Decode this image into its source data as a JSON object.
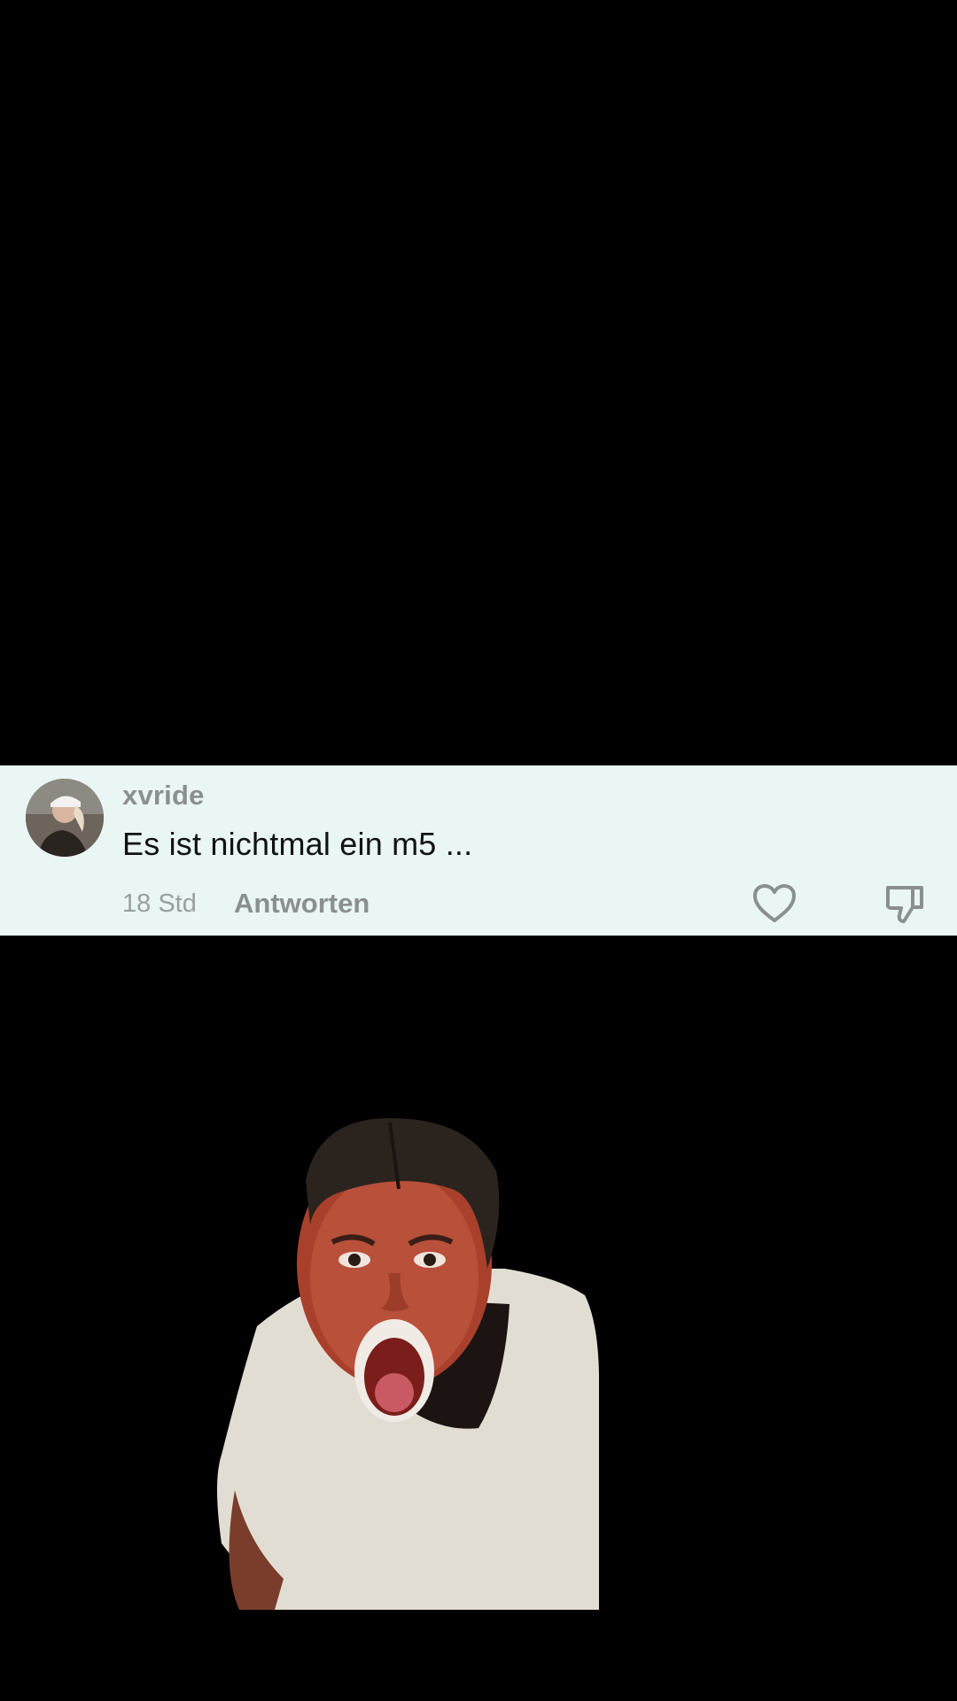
{
  "comment": {
    "username": "xvride",
    "text": "Es ist nichtmal ein m5 ...",
    "time": "18 Std",
    "reply_label": "Antworten",
    "like_icon": "heart-outline-icon",
    "dislike_icon": "thumbs-down-icon"
  },
  "colors": {
    "background": "#000000",
    "card_background": "#eaf6f4",
    "username": "#8a8f8f",
    "comment_text": "#121212",
    "meta_text": "#9aa0a0"
  }
}
